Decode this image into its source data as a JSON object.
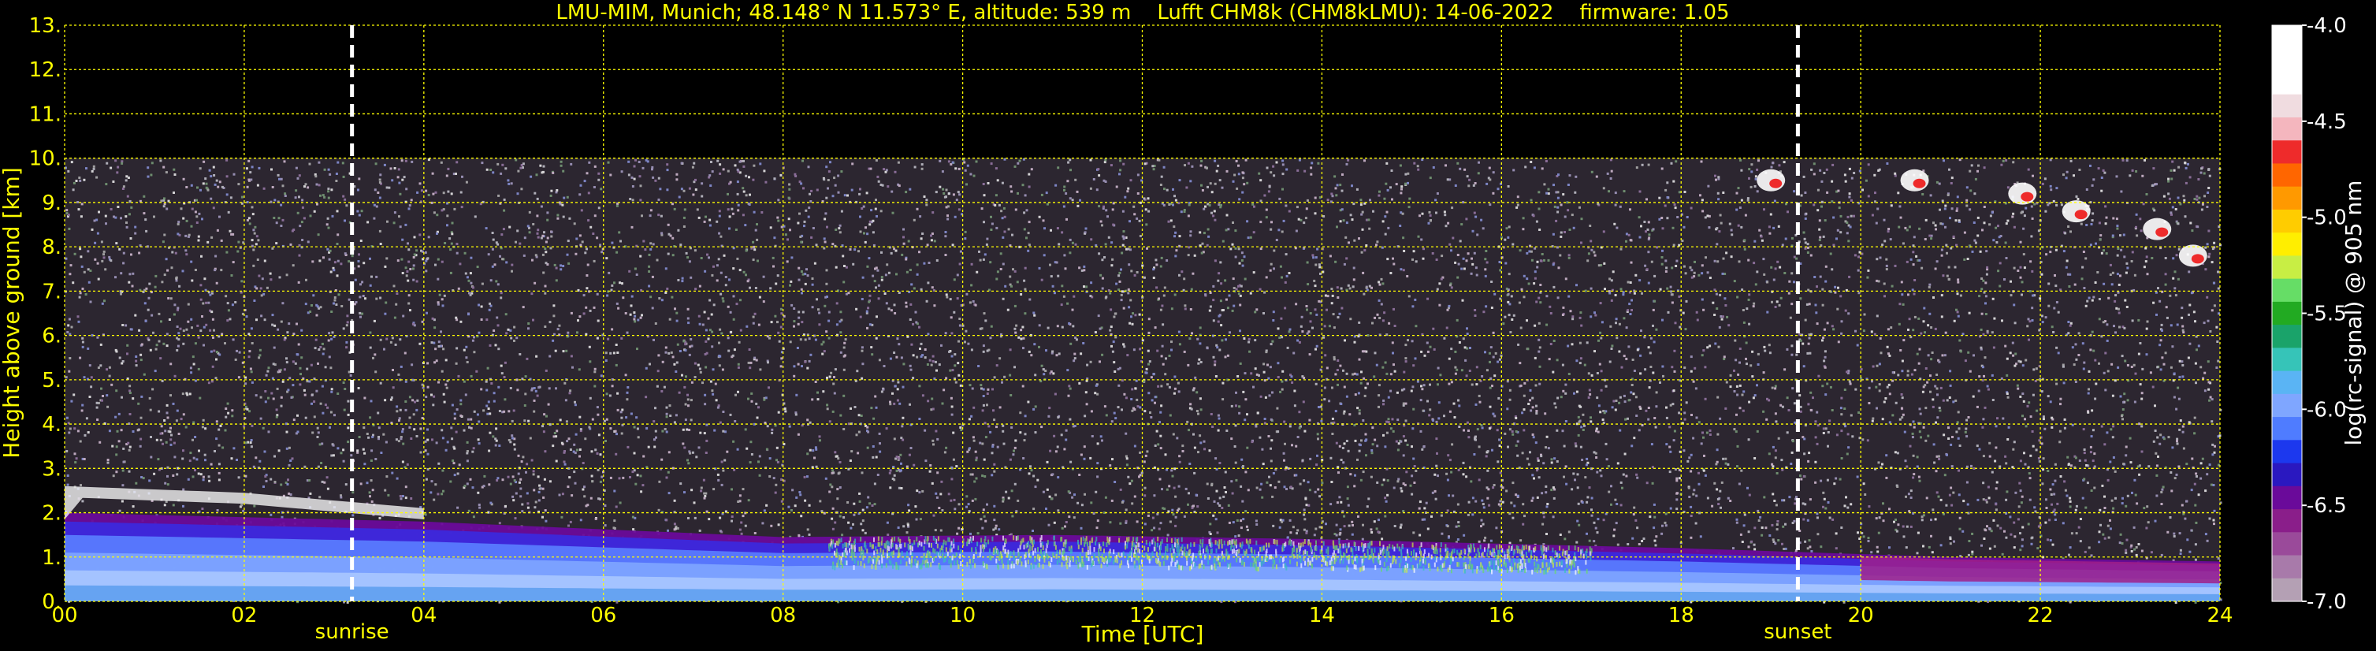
{
  "chart_data": {
    "type": "heatmap",
    "title": "LMU-MIM, Munich; 48.148° N 11.573° E, altitude: 539 m    Lufft CHM8k (CHM8kLMU): 14-06-2022    firmware: 1.05",
    "xlabel": "Time [UTC]",
    "ylabel": "Height above ground [km]",
    "xlim": [
      0,
      24
    ],
    "ylim": [
      0,
      13
    ],
    "x_ticks": [
      "00",
      "02",
      "04",
      "06",
      "08",
      "10",
      "12",
      "14",
      "16",
      "18",
      "20",
      "22",
      "24"
    ],
    "y_ticks": [
      "0.",
      "1.",
      "2.",
      "3.",
      "4.",
      "5.",
      "6.",
      "7.",
      "8.",
      "9.",
      "10.",
      "11.",
      "12.",
      "13."
    ],
    "grid": true,
    "signal_top_km": 10,
    "events": [
      {
        "label": "sunrise",
        "time_h": 3.2
      },
      {
        "label": "sunset",
        "time_h": 19.3
      }
    ],
    "colorbar": {
      "label": "log(rc-signal) @ 905 nm",
      "range": [
        -7.0,
        -4.0
      ],
      "ticks": [
        "-4.0",
        "-4.5",
        "-5.0",
        "-5.5",
        "-6.0",
        "-6.5",
        "-7.0"
      ],
      "colors": [
        "#ffffff",
        "#ffffff",
        "#ffffff",
        "#f0dce0",
        "#f4b6be",
        "#ee2b2b",
        "#ff6600",
        "#ff9900",
        "#ffcc00",
        "#ffee00",
        "#c8ee44",
        "#66dd66",
        "#22aa22",
        "#1aa36a",
        "#36c4b8",
        "#5ab4f4",
        "#7fa6ff",
        "#4f7cff",
        "#1c38ee",
        "#2a18c0",
        "#6a0a9a",
        "#8a1e8a",
        "#9a4a9a",
        "#a87aaa",
        "#b4a0b4"
      ],
      "position": "right"
    },
    "features": {
      "boundary_layer_top_km": [
        {
          "t": 0,
          "h": 2.0
        },
        {
          "t": 4,
          "h": 1.8
        },
        {
          "t": 8,
          "h": 1.45
        },
        {
          "t": 11,
          "h": 1.5
        },
        {
          "t": 14,
          "h": 1.4
        },
        {
          "t": 18,
          "h": 1.2
        },
        {
          "t": 21,
          "h": 1.0
        },
        {
          "t": 24,
          "h": 0.9
        }
      ],
      "residual_layer_top_km": [
        {
          "t": 0,
          "h": 2.6
        },
        {
          "t": 2,
          "h": 2.45
        },
        {
          "t": 4,
          "h": 2.1
        }
      ],
      "cirrus_patches": [
        {
          "t": 19.0,
          "h": 9.5
        },
        {
          "t": 20.6,
          "h": 9.5
        },
        {
          "t": 21.8,
          "h": 9.2
        },
        {
          "t": 22.4,
          "h": 8.8
        },
        {
          "t": 23.3,
          "h": 8.4
        },
        {
          "t": 23.7,
          "h": 7.8
        }
      ]
    }
  }
}
